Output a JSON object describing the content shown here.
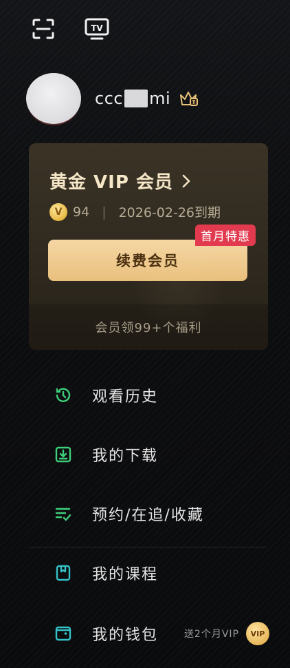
{
  "profile": {
    "username_prefix": "ccc",
    "username_suffix": "mi"
  },
  "vip_card": {
    "title": "黄金 VIP 会员",
    "points": "94",
    "expiry": "2026-02-26到期",
    "promo_badge": "首月特惠",
    "renew_label": "续费会员",
    "benefits_text": "会员领99+个福利"
  },
  "menu": {
    "items": [
      {
        "label": "观看历史",
        "icon": "clock-history-icon",
        "color": "#3ecf7a"
      },
      {
        "label": "我的下载",
        "icon": "download-icon",
        "color": "#3ecf7a"
      },
      {
        "label": "预约/在追/收藏",
        "icon": "list-check-icon",
        "color": "#3ecf7a"
      },
      {
        "label": "我的课程",
        "icon": "bookmark-book-icon",
        "color": "#34c3c9"
      },
      {
        "label": "我的钱包",
        "icon": "wallet-icon",
        "color": "#34c3c9"
      }
    ],
    "wallet_promo": "送2个月VIP",
    "wallet_badge": "VIP"
  },
  "colors": {
    "accent_green": "#3ecf7a",
    "accent_teal": "#34c3c9",
    "gold": "#e9bf7d",
    "promo_red": "#e23b4f"
  }
}
